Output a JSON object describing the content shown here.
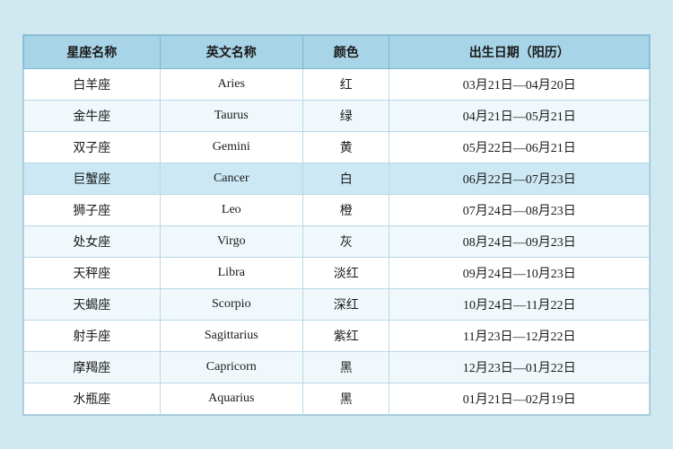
{
  "table": {
    "headers": [
      "星座名称",
      "英文名称",
      "颜色",
      "出生日期（阳历）"
    ],
    "rows": [
      {
        "chinese": "白羊座",
        "english": "Aries",
        "color": "红",
        "dates": "03月21日—04月20日"
      },
      {
        "chinese": "金牛座",
        "english": "Taurus",
        "color": "绿",
        "dates": "04月21日—05月21日"
      },
      {
        "chinese": "双子座",
        "english": "Gemini",
        "color": "黄",
        "dates": "05月22日—06月21日"
      },
      {
        "chinese": "巨蟹座",
        "english": "Cancer",
        "color": "白",
        "dates": "06月22日—07月23日",
        "highlight": true
      },
      {
        "chinese": "狮子座",
        "english": "Leo",
        "color": "橙",
        "dates": "07月24日—08月23日"
      },
      {
        "chinese": "处女座",
        "english": "Virgo",
        "color": "灰",
        "dates": "08月24日—09月23日"
      },
      {
        "chinese": "天秤座",
        "english": "Libra",
        "color": "淡红",
        "dates": "09月24日—10月23日"
      },
      {
        "chinese": "天蝎座",
        "english": "Scorpio",
        "color": "深红",
        "dates": "10月24日—11月22日"
      },
      {
        "chinese": "射手座",
        "english": "Sagittarius",
        "color": "紫红",
        "dates": "11月23日—12月22日"
      },
      {
        "chinese": "摩羯座",
        "english": "Capricorn",
        "color": "黑",
        "dates": "12月23日—01月22日"
      },
      {
        "chinese": "水瓶座",
        "english": "Aquarius",
        "color": "黑",
        "dates": "01月21日—02月19日"
      }
    ]
  }
}
